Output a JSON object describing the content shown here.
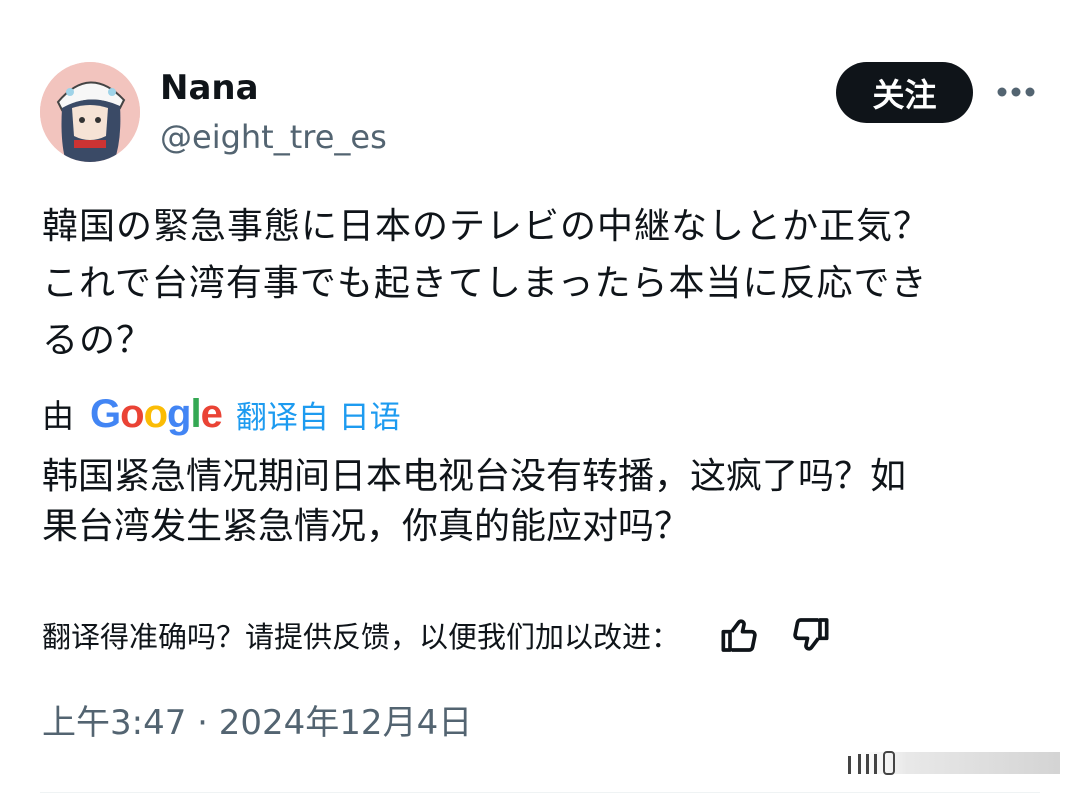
{
  "user": {
    "display_name": "Nana",
    "handle": "@eight_tre_es"
  },
  "header": {
    "follow_label": "关注",
    "more_icon": "more-horizontal-icon"
  },
  "tweet": {
    "text_lines": [
      "韓国の緊急事態に日本のテレビの中継なしとか正気？",
      "これで台湾有事でも起きてしまったら本当に反応でき",
      "るの？"
    ]
  },
  "translation": {
    "prefix": "由",
    "provider": "Google",
    "link_label": "翻译自 日语",
    "text_lines": [
      "韩国紧急情况期间日本电视台没有转播，这疯了吗？如",
      "果台湾发生紧急情况，你真的能应对吗？"
    ],
    "feedback_prompt": "翻译得准确吗？请提供反馈，以便我们加以改进：",
    "thumbs_up_icon": "thumbs-up-icon",
    "thumbs_down_icon": "thumbs-down-icon"
  },
  "meta": {
    "timestamp": "上午3:47 · 2024年12月4日"
  },
  "colors": {
    "text_primary": "#0f1419",
    "text_secondary": "#536471",
    "link": "#1d9bf0",
    "button_bg": "#0f1419"
  }
}
